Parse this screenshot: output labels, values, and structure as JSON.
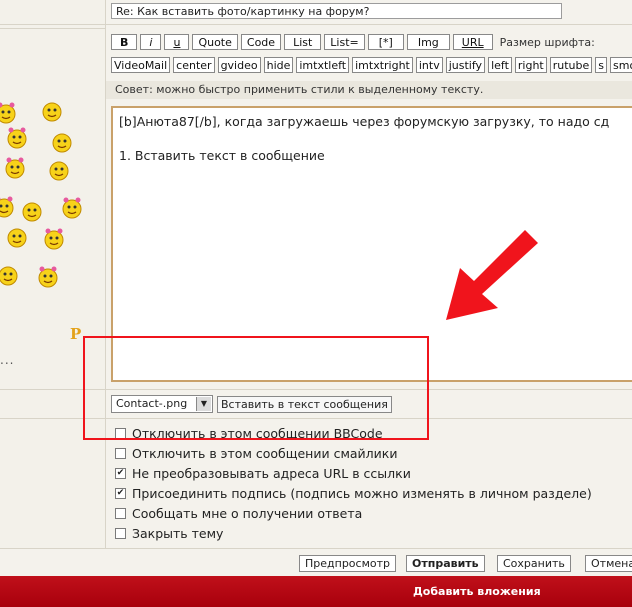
{
  "subject": {
    "value": "Re: Как вставить фото/картинку на форум?"
  },
  "toolbar_row1": [
    "B",
    "i",
    "u",
    "Quote",
    "Code",
    "List",
    "List=",
    "[*]",
    "Img",
    "URL"
  ],
  "font_size_label": "Размер шрифта:",
  "toolbar_row2": [
    "VideoMail",
    "center",
    "gvideo",
    "hide",
    "imtxtleft",
    "imtxtright",
    "intv",
    "justify",
    "left",
    "right",
    "rutube",
    "s",
    "smo"
  ],
  "hint": "Совет: можно быстро применить стили к выделенному тексту.",
  "editor": {
    "line1": "[b]Анюта87[/b], когда загружаешь через форумскую загрузку, то надо сд",
    "line2": "",
    "line3": "1. Вставить текст в сообщение"
  },
  "attachment": {
    "selected": "Contact-.png",
    "insert_label": "Вставить в текст сообщения"
  },
  "options": [
    {
      "label": "Отключить в этом сообщении BBCode",
      "checked": false
    },
    {
      "label": "Отключить в этом сообщении смайлики",
      "checked": false
    },
    {
      "label": "Не преобразовывать адреса URL в ссылки",
      "checked": true
    },
    {
      "label": "Присоединить подпись (подпись можно изменять в личном разделе)",
      "checked": true
    },
    {
      "label": "Сообщать мне о получении ответа",
      "checked": false
    },
    {
      "label": "Закрыть тему",
      "checked": false
    }
  ],
  "buttons": {
    "preview": "Предпросмотр",
    "submit": "Отправить",
    "save": "Сохранить",
    "cancel": "Отмена"
  },
  "footer": {
    "add_attachments": "Добавить вложения"
  },
  "sidebar": {
    "more": "...",
    "badge": "P"
  },
  "colors": {
    "annotation": "#f0141c",
    "footer_bar": "#b00010",
    "editor_border": "#c9a16a"
  }
}
